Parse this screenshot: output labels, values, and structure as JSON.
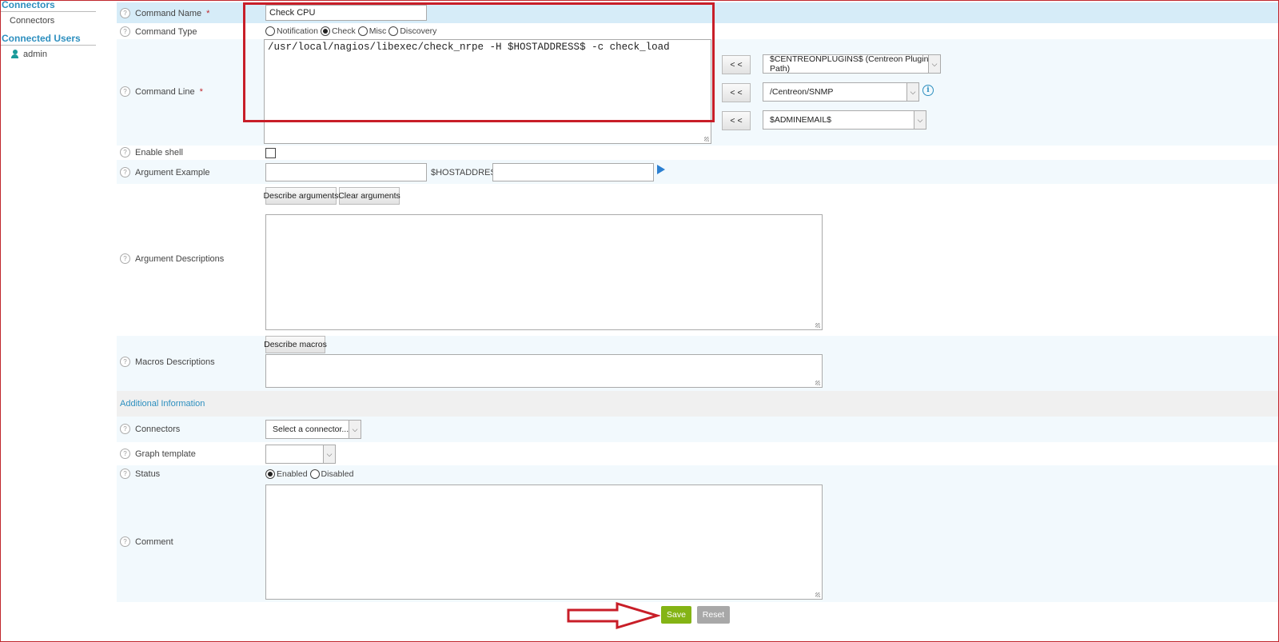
{
  "sidebar": {
    "connectors_header": "Connectors",
    "connectors_item": "Connectors",
    "users_header": "Connected Users",
    "user_name": "admin"
  },
  "form": {
    "command_name": {
      "label": "Command Name",
      "required_mark": "*",
      "value": "Check CPU"
    },
    "command_type": {
      "label": "Command Type",
      "options": [
        "Notification",
        "Check",
        "Misc",
        "Discovery"
      ],
      "selected": "Check"
    },
    "command_line": {
      "label": "Command Line",
      "required_mark": "*",
      "value": "/usr/local/nagios/libexec/check_nrpe -H $HOSTADDRESS$ -c check_load",
      "insert_button": "< <",
      "macro_selects": [
        "$CENTREONPLUGINS$ (Centreon Plugins Path)",
        "/Centreon/SNMP",
        "$ADMINEMAIL$"
      ]
    },
    "enable_shell": {
      "label": "Enable shell",
      "checked": false
    },
    "argument_example": {
      "label": "Argument Example",
      "inline_label": "$HOSTADDRESS$",
      "value1": "",
      "value2": ""
    },
    "describe_arguments_button": "Describe arguments",
    "clear_arguments_button": "Clear arguments",
    "argument_descriptions": {
      "label": "Argument Descriptions"
    },
    "describe_macros_button": "Describe macros",
    "macros_descriptions": {
      "label": "Macros Descriptions"
    },
    "additional_info_title": "Additional Information",
    "connectors": {
      "label": "Connectors",
      "placeholder": "Select a connector..."
    },
    "graph_template": {
      "label": "Graph template",
      "value": ""
    },
    "status": {
      "label": "Status",
      "options": [
        "Enabled",
        "Disabled"
      ],
      "selected": "Enabled"
    },
    "comment": {
      "label": "Comment"
    },
    "save_button": "Save",
    "reset_button": "Reset"
  },
  "colors": {
    "accent": "#2d8fbf",
    "highlight": "#c81e28",
    "save": "#84b415",
    "reset": "#a8a8a8"
  }
}
